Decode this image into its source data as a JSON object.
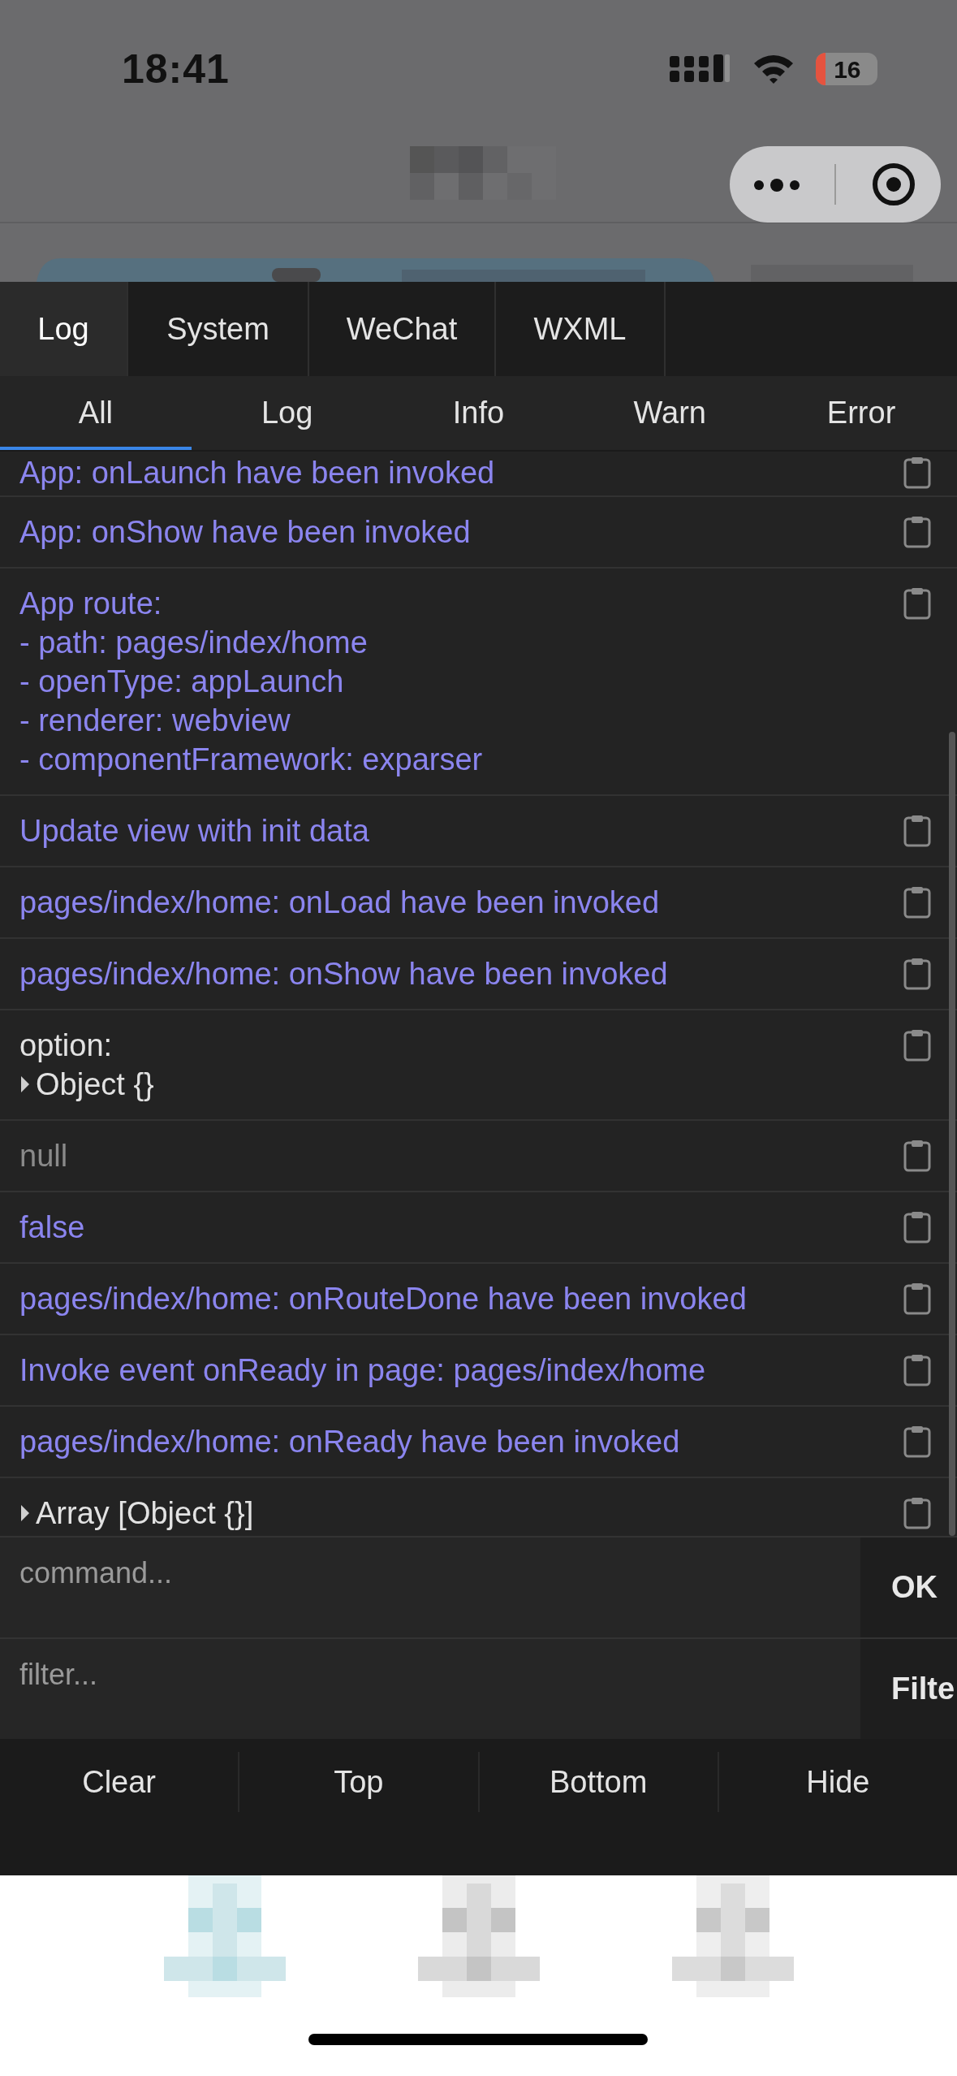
{
  "status_bar": {
    "time": "18:41",
    "battery": "16"
  },
  "devtools": {
    "tabs": [
      {
        "label": "Log",
        "selected": true
      },
      {
        "label": "System",
        "selected": false
      },
      {
        "label": "WeChat",
        "selected": false
      },
      {
        "label": "WXML",
        "selected": false
      }
    ],
    "filters": [
      {
        "label": "All",
        "selected": true
      },
      {
        "label": "Log",
        "selected": false
      },
      {
        "label": "Info",
        "selected": false
      },
      {
        "label": "Warn",
        "selected": false
      },
      {
        "label": "Error",
        "selected": false
      }
    ],
    "logs": [
      {
        "kind": "message",
        "lines": [
          "App: onLaunch have been invoked"
        ]
      },
      {
        "kind": "message",
        "lines": [
          "App: onShow have been invoked"
        ]
      },
      {
        "kind": "message",
        "lines": [
          "App route:",
          "- path: pages/index/home",
          "- openType: appLaunch",
          "- renderer: webview",
          "- componentFramework: exparser"
        ]
      },
      {
        "kind": "message",
        "lines": [
          "Update view with init data"
        ]
      },
      {
        "kind": "message",
        "lines": [
          "pages/index/home: onLoad have been invoked"
        ]
      },
      {
        "kind": "message",
        "lines": [
          "pages/index/home: onShow have been invoked"
        ]
      },
      {
        "kind": "plain",
        "lines": [
          "option:"
        ],
        "object": {
          "label": "Object {}",
          "expanded": false
        }
      },
      {
        "kind": "null",
        "lines": [
          "null"
        ]
      },
      {
        "kind": "message",
        "lines": [
          "false"
        ]
      },
      {
        "kind": "message",
        "lines": [
          "pages/index/home: onRouteDone have been invoked"
        ]
      },
      {
        "kind": "message",
        "lines": [
          "Invoke event onReady in page: pages/index/home"
        ]
      },
      {
        "kind": "message",
        "lines": [
          "pages/index/home: onReady have been invoked"
        ]
      },
      {
        "kind": "plain",
        "object": {
          "label": "Array [Object {}]",
          "expanded": false
        }
      }
    ],
    "command": {
      "placeholder": "command...",
      "button": "OK"
    },
    "filter": {
      "placeholder": "filter...",
      "button": "Filte"
    },
    "actions": [
      "Clear",
      "Top",
      "Bottom",
      "Hide"
    ]
  }
}
